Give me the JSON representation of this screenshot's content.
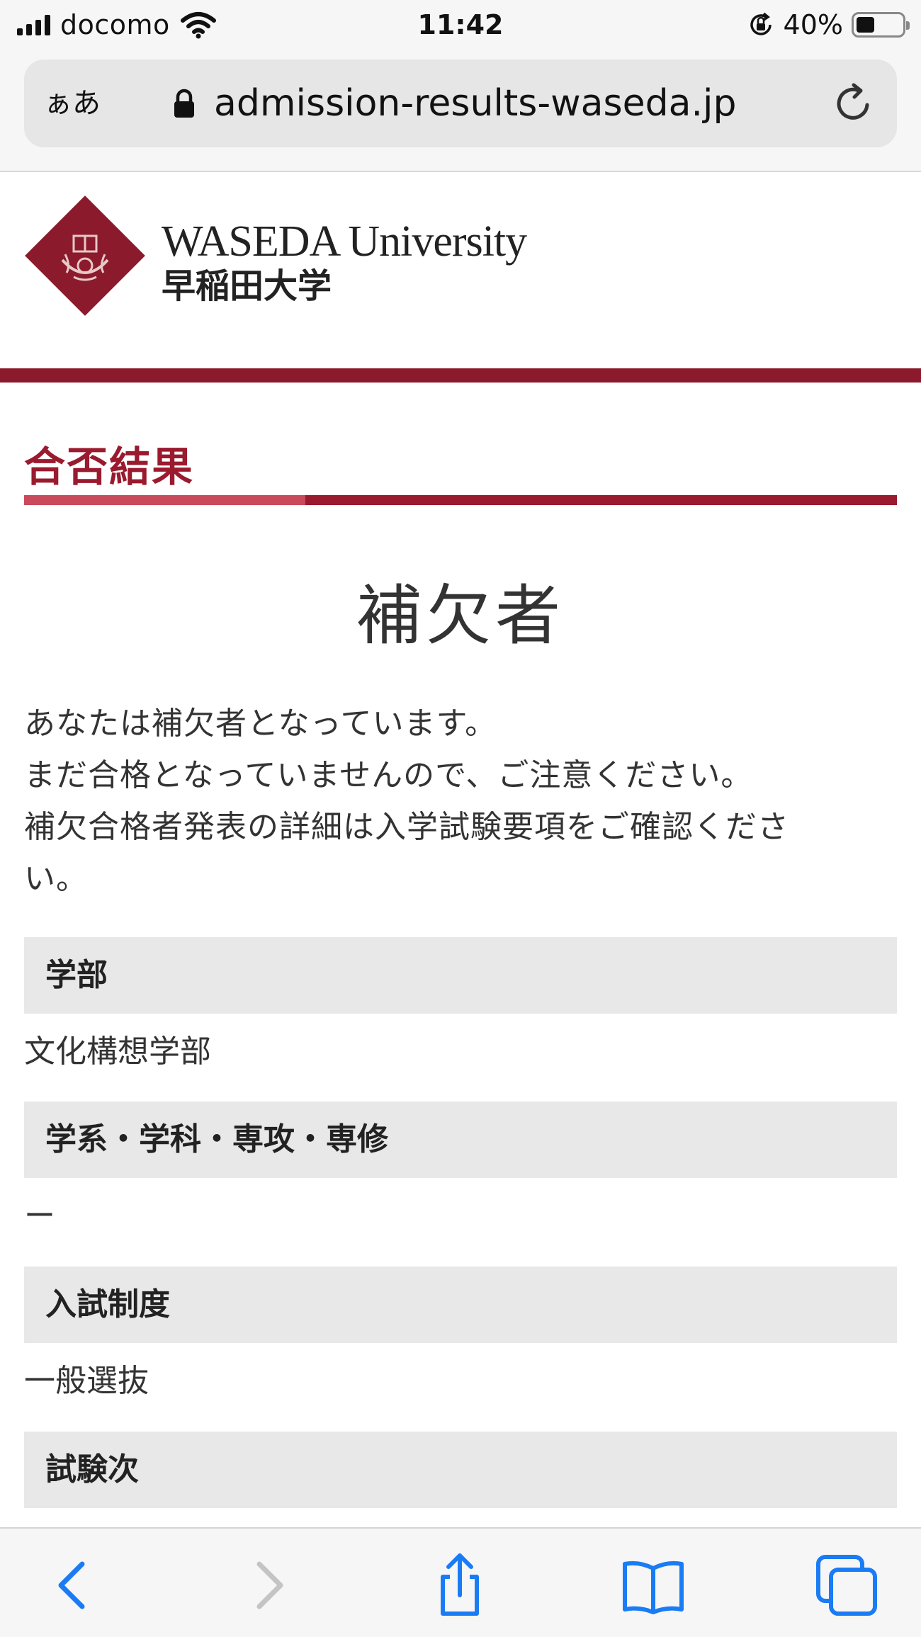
{
  "status_bar": {
    "carrier": "docomo",
    "time": "11:42",
    "battery_percent": "40%",
    "battery_level": 0.4
  },
  "browser": {
    "text_size_button": "ぁあ",
    "url": "admission-results-waseda.jp"
  },
  "site": {
    "name_en": "WASEDA University",
    "name_ja": "早稲田大学"
  },
  "page": {
    "section_title": "合否結果",
    "status": "補欠者",
    "message_lines": [
      "あなたは補欠者となっています。",
      "まだ合格となっていませんので、ご注意ください。",
      "補欠合格者発表の詳細は入学試験要項をご確認くださ",
      "い。"
    ],
    "fields": [
      {
        "label": "学部",
        "value": "文化構想学部"
      },
      {
        "label": "学系・学科・専攻・専修",
        "value": "ー"
      },
      {
        "label": "入試制度",
        "value": "一般選抜"
      },
      {
        "label": "試験次",
        "value": ""
      }
    ]
  },
  "colors": {
    "brand": "#8b1a2c",
    "accent_light": "#c94a5a",
    "ios_blue": "#1a7cf5"
  }
}
